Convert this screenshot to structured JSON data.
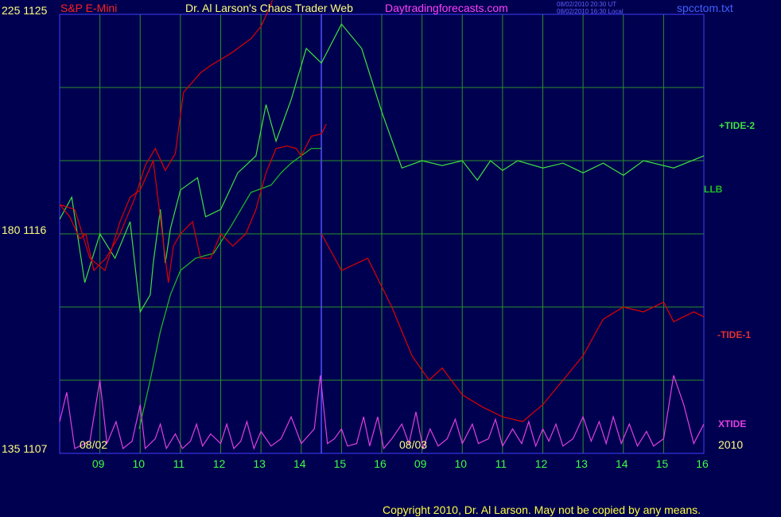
{
  "header": {
    "symbol": "S&P E-Mini",
    "title": "Dr. Al Larson's Chaos Trader Web",
    "site": "Daytradingforecasts.com",
    "stamp_ut": "08/02/2010 20:30 UT",
    "stamp_local": "08/02/2010 16:30 Local",
    "file": "spcctom.txt"
  },
  "footer": {
    "copyright": "Copyright 2010, Dr. Al Larson. May not be copied by any means."
  },
  "colors": {
    "background": "#000050",
    "grid": "#2a8f2a",
    "frame": "#4040ff",
    "tide1": "#e00000",
    "tide2": "#40e040",
    "llb": "#20c020",
    "xtide": "#e040e0",
    "price": "#ffffff",
    "price_down": "#ff2020",
    "avg": "#3030e0",
    "axis_text": "#ffff80",
    "hour_text": "#40ff40",
    "now_line": "#5050ff"
  },
  "chart_data": {
    "type": "line",
    "title": "S&P E-Mini",
    "y_axis_left": {
      "labels": [
        "225 1125",
        "180 1116",
        "135 1107"
      ],
      "range": [
        1107,
        1125
      ],
      "ticks": [
        1125,
        1116,
        1107
      ],
      "angle_ticks": [
        225,
        180,
        135
      ]
    },
    "x_axis": {
      "date_labels": [
        "08/02",
        "08/03",
        "2010"
      ],
      "hour_labels": [
        "09",
        "10",
        "11",
        "12",
        "13",
        "14",
        "15",
        "16",
        "09",
        "10",
        "11",
        "12",
        "13",
        "14",
        "15",
        "16"
      ],
      "sessions": [
        "08/02",
        "08/03"
      ],
      "session_hours": [
        8.5,
        16.5
      ]
    },
    "grid": true,
    "legend": [
      {
        "name": "+TIDE-2",
        "color": "#40e040"
      },
      {
        "name": "LLB",
        "color": "#20c020"
      },
      {
        "name": "-TIDE-1",
        "color": "#e03030"
      },
      {
        "name": "XTIDE",
        "color": "#e040e0"
      }
    ],
    "series": [
      {
        "name": "+TIDE-2",
        "points": [
          [
            0,
            1116.6
          ],
          [
            1.2,
            1117.5
          ],
          [
            2.5,
            1114
          ],
          [
            4,
            1116
          ],
          [
            5.5,
            1115
          ],
          [
            7,
            1116.5
          ],
          [
            8,
            1112.8
          ],
          [
            9,
            1113.5
          ],
          [
            9.3,
            1114.8
          ],
          [
            10,
            1117
          ],
          [
            10.5,
            1114.8
          ],
          [
            11,
            1116.2
          ],
          [
            12,
            1117.8
          ],
          [
            13.7,
            1118.3
          ],
          [
            14.5,
            1116.7
          ],
          [
            16,
            1117
          ],
          [
            17.7,
            1118.5
          ],
          [
            19.5,
            1119.2
          ],
          [
            20.5,
            1121.3
          ],
          [
            21.5,
            1119.8
          ],
          [
            23,
            1121.5
          ],
          [
            24.5,
            1123.6
          ],
          [
            26,
            1123
          ],
          [
            28,
            1124.6
          ],
          [
            30,
            1123.6
          ],
          [
            32,
            1121
          ],
          [
            34,
            1118.7
          ],
          [
            36,
            1119
          ],
          [
            38,
            1118.8
          ],
          [
            40,
            1119
          ],
          [
            41.5,
            1118.2
          ],
          [
            42.8,
            1119
          ],
          [
            44,
            1118.6
          ],
          [
            45.5,
            1119
          ],
          [
            48,
            1118.7
          ],
          [
            50,
            1118.9
          ],
          [
            52,
            1118.5
          ],
          [
            54,
            1118.9
          ],
          [
            56,
            1118.4
          ],
          [
            58,
            1119
          ],
          [
            61,
            1118.7
          ],
          [
            64,
            1119.2
          ]
        ]
      },
      {
        "name": "LLB",
        "points": [
          [
            7.9,
            1108
          ],
          [
            9,
            1110
          ],
          [
            10,
            1112
          ],
          [
            11,
            1113.5
          ],
          [
            12,
            1114.5
          ],
          [
            13.5,
            1115
          ],
          [
            15.3,
            1115.2
          ],
          [
            17,
            1116.3
          ],
          [
            19,
            1117.7
          ],
          [
            21,
            1118
          ],
          [
            22,
            1118.5
          ],
          [
            23,
            1118.9
          ],
          [
            24,
            1119.2
          ],
          [
            25,
            1119.5
          ],
          [
            26,
            1119.5
          ]
        ]
      },
      {
        "name": "-TIDE-1",
        "points": [
          [
            0,
            1117.2
          ],
          [
            1,
            1116.7
          ],
          [
            2,
            1115.8
          ],
          [
            2.6,
            1116
          ],
          [
            3.4,
            1114.5
          ],
          [
            4.6,
            1115
          ],
          [
            6,
            1116
          ],
          [
            7.5,
            1117.5
          ],
          [
            8.5,
            1118.8
          ],
          [
            9.5,
            1119.5
          ],
          [
            10.5,
            1118.6
          ],
          [
            11.5,
            1119.3
          ],
          [
            12.3,
            1121.8
          ],
          [
            14,
            1122.6
          ],
          [
            15,
            1122.9
          ],
          [
            17,
            1123.4
          ],
          [
            19,
            1124
          ],
          [
            20,
            1124.5
          ],
          [
            21,
            1125.4
          ],
          [
            22,
            1127
          ]
        ]
      },
      {
        "name": "-TIDE-1b",
        "points": [
          [
            0,
            1117.2
          ],
          [
            1.5,
            1117
          ],
          [
            3,
            1115
          ],
          [
            4.5,
            1114.5
          ],
          [
            6,
            1116.5
          ],
          [
            7,
            1117.5
          ],
          [
            8,
            1117.8
          ],
          [
            9.3,
            1119
          ],
          [
            10.2,
            1116
          ],
          [
            10.8,
            1114
          ],
          [
            11.3,
            1115.5
          ],
          [
            12,
            1116
          ],
          [
            13.2,
            1116.5
          ],
          [
            14,
            1115
          ],
          [
            15,
            1115
          ],
          [
            16,
            1116
          ],
          [
            17.2,
            1115.5
          ],
          [
            18.5,
            1116
          ],
          [
            19.5,
            1117
          ],
          [
            20.5,
            1118.5
          ],
          [
            21.5,
            1119.5
          ],
          [
            22.6,
            1119.6
          ],
          [
            23.5,
            1119.5
          ],
          [
            24,
            1119.2
          ],
          [
            25,
            1120
          ],
          [
            26,
            1120.1
          ],
          [
            26.5,
            1120.5
          ]
        ]
      },
      {
        "name": "XTIDE",
        "points": [
          [
            0,
            1108.3
          ],
          [
            0.7,
            1109.5
          ],
          [
            1.5,
            1107.2
          ],
          [
            3,
            1107.5
          ],
          [
            4,
            1110
          ],
          [
            4.7,
            1107.4
          ],
          [
            5.6,
            1108.3
          ],
          [
            6.3,
            1107.2
          ],
          [
            7.2,
            1107.5
          ],
          [
            8,
            1109
          ],
          [
            8.5,
            1107.2
          ],
          [
            9.5,
            1107.6
          ],
          [
            10,
            1108.2
          ],
          [
            10.6,
            1107.2
          ],
          [
            11.5,
            1107.8
          ],
          [
            12.2,
            1107.2
          ],
          [
            13,
            1107.5
          ],
          [
            13.6,
            1108.2
          ],
          [
            14.2,
            1107.3
          ],
          [
            15,
            1107.8
          ],
          [
            16,
            1107.4
          ],
          [
            16.6,
            1108.2
          ],
          [
            17.3,
            1107.2
          ],
          [
            18,
            1107.5
          ],
          [
            18.6,
            1108.3
          ],
          [
            19.3,
            1107.2
          ],
          [
            20,
            1107.9
          ],
          [
            21,
            1107.3
          ],
          [
            22,
            1107.6
          ],
          [
            23,
            1108.5
          ],
          [
            24,
            1107.4
          ],
          [
            25.3,
            1108
          ],
          [
            25.9,
            1110.2
          ],
          [
            26.6,
            1107.4
          ],
          [
            27.3,
            1107.6
          ],
          [
            28,
            1108
          ],
          [
            28.6,
            1107.3
          ],
          [
            29.5,
            1107.4
          ],
          [
            30.2,
            1108.5
          ],
          [
            30.8,
            1107.3
          ],
          [
            31.6,
            1108.5
          ],
          [
            32.2,
            1107.2
          ],
          [
            33,
            1107.6
          ],
          [
            34,
            1108.2
          ],
          [
            34.7,
            1107.4
          ],
          [
            35.4,
            1108.7
          ],
          [
            36.1,
            1107.2
          ],
          [
            36.8,
            1108
          ],
          [
            37.6,
            1107.3
          ],
          [
            38.5,
            1107.6
          ],
          [
            39.3,
            1108.4
          ],
          [
            40,
            1107.4
          ],
          [
            41,
            1108.2
          ],
          [
            41.6,
            1107.4
          ],
          [
            42.6,
            1107.6
          ],
          [
            43.3,
            1108.4
          ],
          [
            44,
            1107.3
          ],
          [
            45,
            1108
          ],
          [
            45.9,
            1107.4
          ],
          [
            46.6,
            1108.3
          ],
          [
            47.3,
            1107.3
          ],
          [
            48,
            1108
          ],
          [
            48.6,
            1107.5
          ],
          [
            49.3,
            1108.2
          ],
          [
            50,
            1107.3
          ],
          [
            51,
            1107.6
          ],
          [
            52,
            1108.5
          ],
          [
            52.8,
            1107.5
          ],
          [
            53.6,
            1108.3
          ],
          [
            54.3,
            1107.4
          ],
          [
            55,
            1108.5
          ],
          [
            55.8,
            1107.4
          ],
          [
            56.6,
            1108.2
          ],
          [
            57.4,
            1107.3
          ],
          [
            58.3,
            1107.9
          ],
          [
            59,
            1107.3
          ],
          [
            60,
            1107.6
          ],
          [
            61,
            1110.2
          ],
          [
            62,
            1109
          ],
          [
            63,
            1107.4
          ],
          [
            64,
            1108.2
          ]
        ]
      },
      {
        "name": "-TIDE-1-right",
        "points": [
          [
            26,
            1116
          ],
          [
            28,
            1114.5
          ],
          [
            30.6,
            1115
          ],
          [
            33,
            1113
          ],
          [
            35,
            1111
          ],
          [
            36.7,
            1110
          ],
          [
            38,
            1110.5
          ],
          [
            40,
            1109.4
          ],
          [
            42,
            1108.9
          ],
          [
            44,
            1108.5
          ],
          [
            46,
            1108.3
          ],
          [
            48,
            1109
          ],
          [
            50,
            1110
          ],
          [
            52,
            1111
          ],
          [
            54,
            1112.5
          ],
          [
            56,
            1113
          ],
          [
            58,
            1112.8
          ],
          [
            60,
            1113.2
          ],
          [
            61,
            1112.4
          ],
          [
            63,
            1112.8
          ],
          [
            64,
            1112.6
          ]
        ]
      }
    ]
  }
}
